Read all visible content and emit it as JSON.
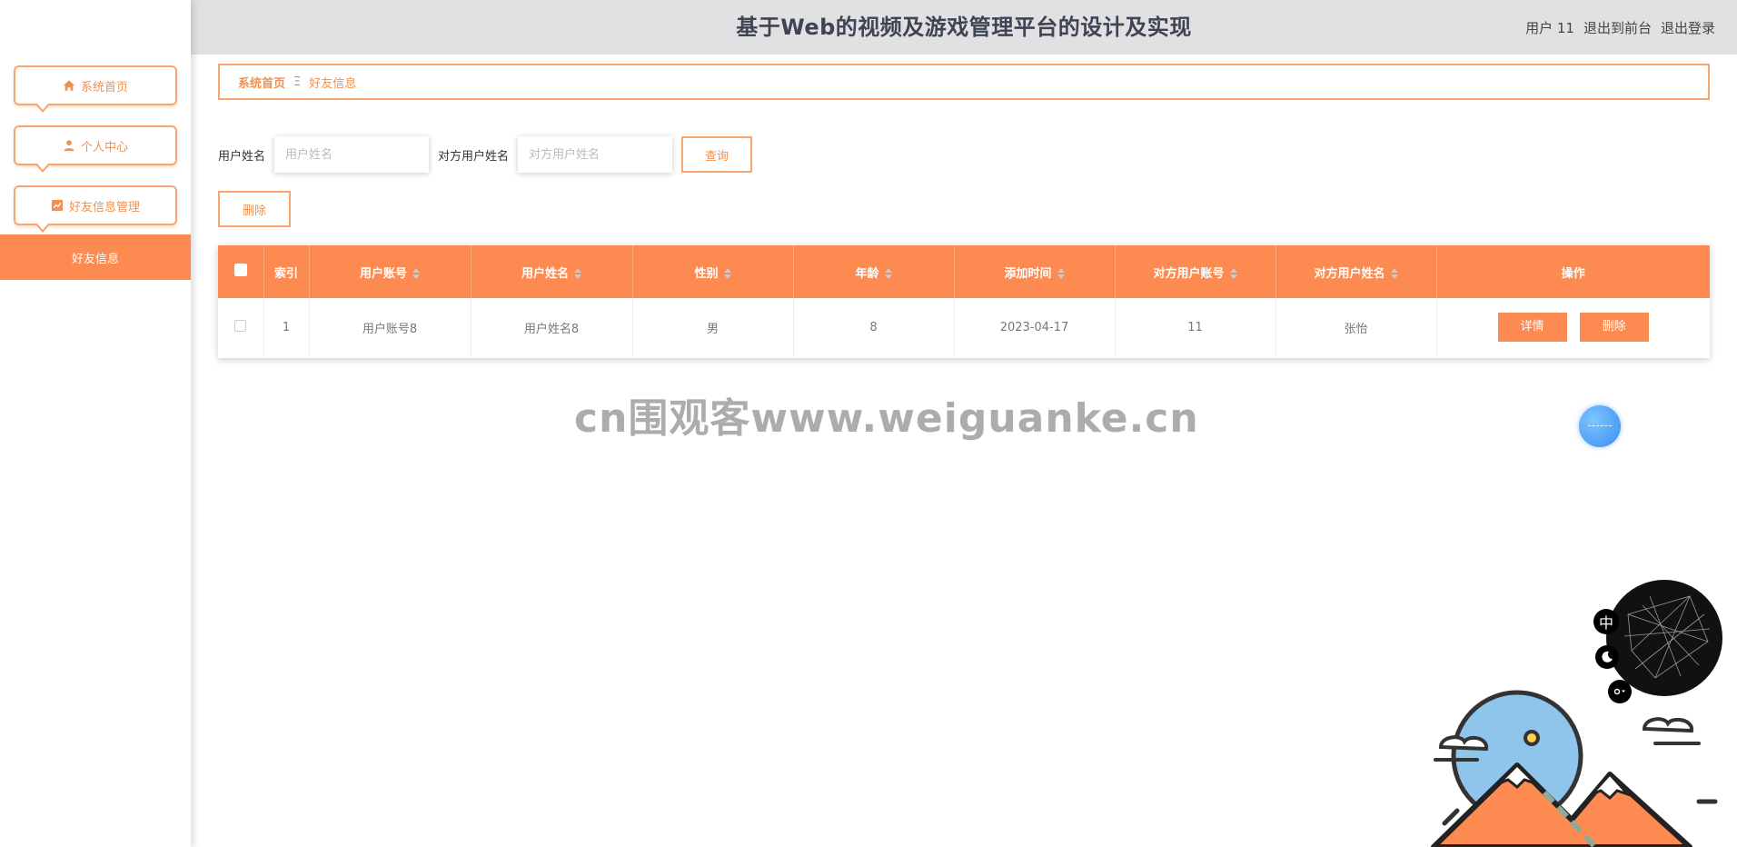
{
  "header": {
    "title": "基于Web的视频及游戏管理平台的设计及实现",
    "user": "用户 11",
    "to_front": "退出到前台",
    "logout": "退出登录"
  },
  "sidebar": {
    "items": [
      {
        "label": "系统首页",
        "icon": "home-icon"
      },
      {
        "label": "个人中心",
        "icon": "user-icon"
      },
      {
        "label": "好友信息管理",
        "icon": "chart-icon"
      }
    ],
    "active_sub": "好友信息"
  },
  "breadcrumb": {
    "home": "系统首页",
    "separator": "Ξ",
    "current": "好友信息"
  },
  "search": {
    "user_name_label": "用户姓名",
    "user_name_placeholder": "用户姓名",
    "other_name_label": "对方用户姓名",
    "other_name_placeholder": "对方用户姓名",
    "query_label": "查询"
  },
  "actions": {
    "delete_label": "删除"
  },
  "table": {
    "columns": [
      "索引",
      "用户账号",
      "用户姓名",
      "性别",
      "年龄",
      "添加时间",
      "对方用户账号",
      "对方用户姓名",
      "操作"
    ],
    "rows": [
      {
        "index": "1",
        "account": "用户账号8",
        "name": "用户姓名8",
        "gender": "男",
        "age": "8",
        "added": "2023-04-17",
        "other_account": "11",
        "other_name": "张怡",
        "detail_label": "详情",
        "delete_label": "删除"
      }
    ]
  },
  "watermark": "cn围观客www.weiguanke.cn",
  "widget": {
    "lang": "中"
  },
  "colors": {
    "accent": "#fd8b51",
    "accent_border": "#f6a66e",
    "header_bg": "#e1e1e3",
    "title": "#3f4454"
  }
}
